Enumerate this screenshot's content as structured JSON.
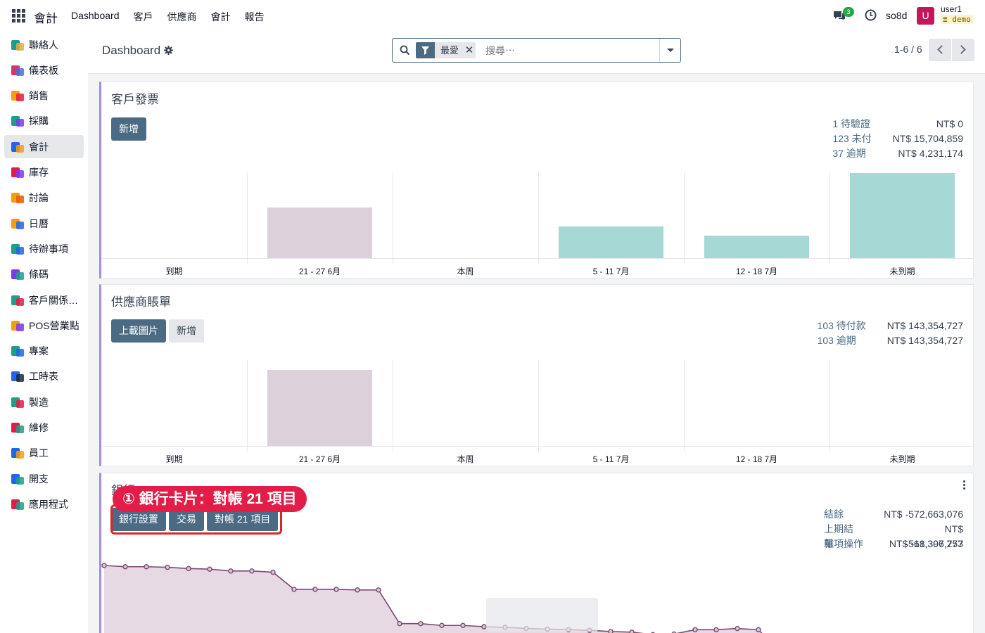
{
  "app": {
    "brand": "會計",
    "menu": [
      "Dashboard",
      "客戶",
      "供應商",
      "會計",
      "報告"
    ]
  },
  "systray": {
    "chat_count": "3",
    "db_name": "so8d",
    "avatar_letter": "U",
    "user": "user1",
    "db_badge": "demo"
  },
  "sidebar": {
    "items": [
      {
        "label": "聯絡人",
        "icon": "contacts-icon"
      },
      {
        "label": "儀表板",
        "icon": "dashboards-icon"
      },
      {
        "label": "銷售",
        "icon": "sales-icon"
      },
      {
        "label": "採購",
        "icon": "purchase-icon"
      },
      {
        "label": "會計",
        "icon": "accounting-icon"
      },
      {
        "label": "庫存",
        "icon": "inventory-icon"
      },
      {
        "label": "討論",
        "icon": "discuss-icon"
      },
      {
        "label": "日曆",
        "icon": "calendar-icon"
      },
      {
        "label": "待辦事項",
        "icon": "todo-icon"
      },
      {
        "label": "條碼",
        "icon": "barcode-icon"
      },
      {
        "label": "客戶關係…",
        "icon": "crm-icon"
      },
      {
        "label": "POS營業點",
        "icon": "pos-icon"
      },
      {
        "label": "專案",
        "icon": "project-icon"
      },
      {
        "label": "工時表",
        "icon": "timesheet-icon"
      },
      {
        "label": "製造",
        "icon": "manufacturing-icon"
      },
      {
        "label": "維修",
        "icon": "repair-icon"
      },
      {
        "label": "員工",
        "icon": "employees-icon"
      },
      {
        "label": "開支",
        "icon": "expenses-icon"
      },
      {
        "label": "應用程式",
        "icon": "apps-icon"
      }
    ],
    "active_index": 4
  },
  "control_panel": {
    "breadcrumb": "Dashboard",
    "facet": "最愛",
    "search_placeholder": "搜尋⋯",
    "pager": "1-6 / 6"
  },
  "cards": {
    "customer_invoices": {
      "title": "客戶發票",
      "buttons": [
        "新增"
      ],
      "stats": [
        {
          "label": "1 待驗證",
          "value": "NT$ 0"
        },
        {
          "label": "123 未付",
          "value": "NT$ 15,704,859"
        },
        {
          "label": "37 逾期",
          "value": "NT$ 4,231,174"
        }
      ],
      "chart_data": {
        "type": "bar",
        "categories": [
          "到期",
          "21 - 27 6月",
          "本周",
          "5 - 11 7月",
          "12 - 18 7月",
          "未到期"
        ],
        "values": [
          0,
          72,
          0,
          45,
          32,
          121
        ],
        "bar_colors": [
          "#dcd1da",
          "#dcd1da",
          "#dcd1da",
          "#a6d8d6",
          "#a6d8d6",
          "#a6d8d6"
        ]
      }
    },
    "vendor_bills": {
      "title": "供應商賬單",
      "buttons": [
        "上載圖片",
        "新增"
      ],
      "stats": [
        {
          "label": "103 待付款",
          "value": "NT$ 143,354,727"
        },
        {
          "label": "103 逾期",
          "value": "NT$ 143,354,727"
        }
      ],
      "chart_data": {
        "type": "bar",
        "categories": [
          "到期",
          "21 - 27 6月",
          "本周",
          "5 - 11 7月",
          "12 - 18 7月",
          "未到期"
        ],
        "values": [
          0,
          108,
          0,
          0,
          0,
          0
        ],
        "bar_colors": [
          "#dcd1da",
          "#dcd1da",
          "#dcd1da",
          "#a6d8d6",
          "#a6d8d6",
          "#a6d8d6"
        ]
      }
    },
    "bank": {
      "title": "銀行",
      "buttons": [
        "銀行設置",
        "交易",
        "對帳 21 項目"
      ],
      "callout": "① 銀行卡片：對帳 21 項目",
      "stats": [
        {
          "label": "結餘",
          "value": "NT$ -572,663,076"
        },
        {
          "label": "上期結單",
          "value": "NT$ -561,307,757"
        },
        {
          "label": "雜項操作",
          "value": "NT$ -18,396,273"
        }
      ],
      "chart_data": {
        "type": "area",
        "values": [
          100,
          99.8,
          99.8,
          99.7,
          99.5,
          99.4,
          99.1,
          99.1,
          98.9,
          96.1,
          96.1,
          96.1,
          96.0,
          96.0,
          90.5,
          90.5,
          90.2,
          90.2,
          90.0,
          89.9,
          89.7,
          89.6,
          89.5,
          89.4,
          89.2,
          89.1,
          88.7,
          88.8,
          89.5,
          89.5,
          89.7,
          89.5,
          86.0,
          85.7
        ]
      }
    }
  },
  "colors": {
    "primary": "#4b6b84",
    "accent_border": "#a78bde",
    "callout": "#e11d48",
    "line": "#7b4a72",
    "area": "#e6d9e3"
  }
}
